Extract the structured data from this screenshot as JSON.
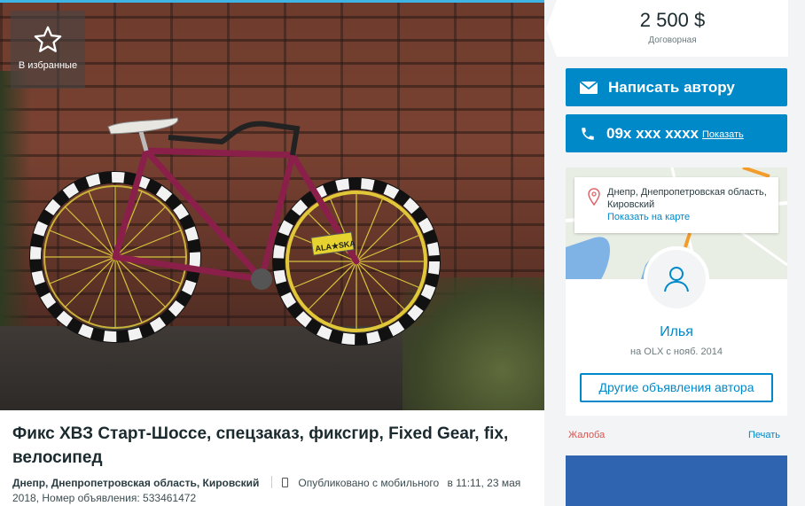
{
  "gallery": {
    "favorite_label": "В избранные",
    "favorite_icon": "star-outline-icon",
    "plate_text": "ALA★SKA"
  },
  "listing": {
    "title": "Фикс ХВЗ Старт-Шоссе, спецзаказ, фиксгир, Fixed Gear, fix, велосипед",
    "location": "Днепр, Днепропетровская область, Кировский",
    "published": "Опубликовано с мобильного",
    "time_prefix": "в 11:11, 23 мая",
    "time_rest": "2018, Номер объявления: 533461472"
  },
  "price": {
    "amount": "2 500 $",
    "note": "Договорная"
  },
  "actions": {
    "message_label": "Написать автору",
    "phone_masked": "09x xxx xxxx",
    "phone_show": "Показать"
  },
  "author": {
    "address": "Днепр, Днепропетровская область, Кировский",
    "show_on_map": "Показать на карте",
    "name": "Илья",
    "since": "на OLX с нояб. 2014",
    "other_ads": "Другие объявления автора"
  },
  "footer": {
    "report": "Жалоба",
    "print": "Печать"
  },
  "colors": {
    "accent": "#0089c9",
    "report": "#d9534f",
    "banner": "#2e64b0"
  }
}
